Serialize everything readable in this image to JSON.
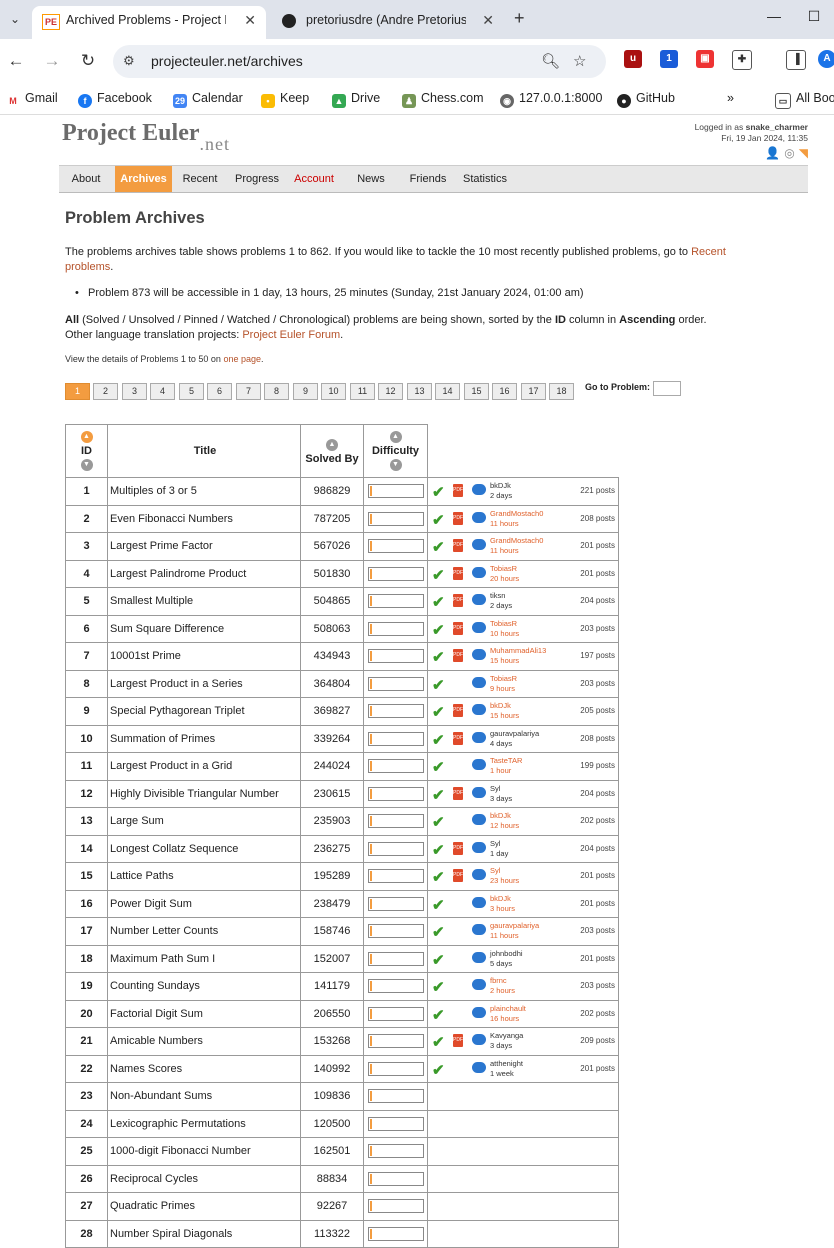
{
  "browser": {
    "tabs": [
      {
        "title": "Archived Problems - Project Eul",
        "favicon": "PE"
      },
      {
        "title": "pretoriusdre (Andre Pretorius)",
        "favicon": "github-icon"
      }
    ],
    "url": "projecteuler.net/archives",
    "bookmarks": [
      "Gmail",
      "Facebook",
      "Calendar",
      "Keep",
      "Drive",
      "Chess.com",
      "127.0.0.1:8000",
      "GitHub",
      "All Boo"
    ],
    "ext_badge": "1",
    "profile_initial": "A"
  },
  "site": {
    "logo": "Project Euler",
    "logo_suffix": ".net",
    "login_line1_prefix": "Logged in as ",
    "login_user": "snake_charmer",
    "login_line2": "Fri, 19 Jan 2024, 11:35"
  },
  "menu": [
    "About",
    "Archives",
    "Recent",
    "Progress",
    "Account",
    "News",
    "Friends",
    "Statistics"
  ],
  "page": {
    "title": "Problem Archives",
    "intro": "The problems archives table shows problems 1 to 862. If you would like to tackle the 10 most recently published problems, go to ",
    "intro_link": "Recent problems",
    "intro_end": ".",
    "bullet": "Problem 873 will be accessible in 1 day, 13 hours, 25 minutes (Sunday, 21st January 2024, 01:00 am)",
    "filter_all": "All",
    "filter_rest": " (Solved / Unsolved / Pinned / Watched / Chronological) problems are being shown, sorted by the ",
    "filter_col": "ID",
    "filter_mid": " column in ",
    "filter_order": "Ascending",
    "filter_end": " order.",
    "translation": "Other language translation projects: ",
    "translation_link": "Project Euler Forum",
    "translation_end": ".",
    "details_prefix": "View the details of Problems 1 to 50 on ",
    "details_link": "one page",
    "details_end": ".",
    "pages": [
      "1",
      "2",
      "3",
      "4",
      "5",
      "6",
      "7",
      "8",
      "9",
      "10",
      "11",
      "12",
      "13",
      "14",
      "15",
      "16",
      "17",
      "18"
    ],
    "goto_label": "Go to Problem:"
  },
  "table": {
    "headers": {
      "id": "ID",
      "title": "Title",
      "solved": "Solved By",
      "difficulty": "Difficulty"
    },
    "rows": [
      {
        "id": "1",
        "title": "Multiples of 3 or 5",
        "solved": "986829",
        "solved_me": true,
        "pdf": true,
        "forum": true,
        "user": "bkDJk",
        "ago": "2 days",
        "user_orange": false,
        "posts": "221 posts"
      },
      {
        "id": "2",
        "title": "Even Fibonacci Numbers",
        "solved": "787205",
        "solved_me": true,
        "pdf": true,
        "forum": true,
        "user": "GrandMostach0",
        "ago": "11 hours",
        "user_orange": true,
        "posts": "208 posts"
      },
      {
        "id": "3",
        "title": "Largest Prime Factor",
        "solved": "567026",
        "solved_me": true,
        "pdf": true,
        "forum": true,
        "user": "GrandMostach0",
        "ago": "11 hours",
        "user_orange": true,
        "posts": "201 posts"
      },
      {
        "id": "4",
        "title": "Largest Palindrome Product",
        "solved": "501830",
        "solved_me": true,
        "pdf": true,
        "forum": true,
        "user": "TobiasR",
        "ago": "20 hours",
        "user_orange": true,
        "posts": "201 posts"
      },
      {
        "id": "5",
        "title": "Smallest Multiple",
        "solved": "504865",
        "solved_me": true,
        "pdf": true,
        "forum": true,
        "user": "tiksn",
        "ago": "2 days",
        "user_orange": false,
        "posts": "204 posts"
      },
      {
        "id": "6",
        "title": "Sum Square Difference",
        "solved": "508063",
        "solved_me": true,
        "pdf": true,
        "forum": true,
        "user": "TobiasR",
        "ago": "10 hours",
        "user_orange": true,
        "posts": "203 posts"
      },
      {
        "id": "7",
        "title": "10001st Prime",
        "solved": "434943",
        "solved_me": true,
        "pdf": true,
        "forum": true,
        "user": "MuhammadAli13",
        "ago": "15 hours",
        "user_orange": true,
        "posts": "197 posts"
      },
      {
        "id": "8",
        "title": "Largest Product in a Series",
        "solved": "364804",
        "solved_me": true,
        "pdf": false,
        "forum": true,
        "user": "TobiasR",
        "ago": "9 hours",
        "user_orange": true,
        "posts": "203 posts"
      },
      {
        "id": "9",
        "title": "Special Pythagorean Triplet",
        "solved": "369827",
        "solved_me": true,
        "pdf": true,
        "forum": true,
        "user": "bkDJk",
        "ago": "15 hours",
        "user_orange": true,
        "posts": "205 posts"
      },
      {
        "id": "10",
        "title": "Summation of Primes",
        "solved": "339264",
        "solved_me": true,
        "pdf": true,
        "forum": true,
        "user": "gauravpalariya",
        "ago": "4 days",
        "user_orange": false,
        "posts": "208 posts"
      },
      {
        "id": "11",
        "title": "Largest Product in a Grid",
        "solved": "244024",
        "solved_me": true,
        "pdf": false,
        "forum": true,
        "user": "TasteTAR",
        "ago": "1 hour",
        "user_orange": true,
        "posts": "199 posts"
      },
      {
        "id": "12",
        "title": "Highly Divisible Triangular Number",
        "solved": "230615",
        "solved_me": true,
        "pdf": true,
        "forum": true,
        "user": "Syl",
        "ago": "3 days",
        "user_orange": false,
        "posts": "204 posts"
      },
      {
        "id": "13",
        "title": "Large Sum",
        "solved": "235903",
        "solved_me": true,
        "pdf": false,
        "forum": true,
        "user": "bkDJk",
        "ago": "12 hours",
        "user_orange": true,
        "posts": "202 posts"
      },
      {
        "id": "14",
        "title": "Longest Collatz Sequence",
        "solved": "236275",
        "solved_me": true,
        "pdf": true,
        "forum": true,
        "user": "Syl",
        "ago": "1 day",
        "user_orange": false,
        "posts": "204 posts"
      },
      {
        "id": "15",
        "title": "Lattice Paths",
        "solved": "195289",
        "solved_me": true,
        "pdf": true,
        "forum": true,
        "user": "Syl",
        "ago": "23 hours",
        "user_orange": true,
        "posts": "201 posts"
      },
      {
        "id": "16",
        "title": "Power Digit Sum",
        "solved": "238479",
        "solved_me": true,
        "pdf": false,
        "forum": true,
        "user": "bkDJk",
        "ago": "3 hours",
        "user_orange": true,
        "posts": "201 posts"
      },
      {
        "id": "17",
        "title": "Number Letter Counts",
        "solved": "158746",
        "solved_me": true,
        "pdf": false,
        "forum": true,
        "user": "gauravpalariya",
        "ago": "11 hours",
        "user_orange": true,
        "posts": "203 posts"
      },
      {
        "id": "18",
        "title": "Maximum Path Sum I",
        "solved": "152007",
        "solved_me": true,
        "pdf": false,
        "forum": true,
        "user": "johnbodhi",
        "ago": "5 days",
        "user_orange": false,
        "posts": "201 posts"
      },
      {
        "id": "19",
        "title": "Counting Sundays",
        "solved": "141179",
        "solved_me": true,
        "pdf": false,
        "forum": true,
        "user": "fbrnc",
        "ago": "2 hours",
        "user_orange": true,
        "posts": "203 posts"
      },
      {
        "id": "20",
        "title": "Factorial Digit Sum",
        "solved": "206550",
        "solved_me": true,
        "pdf": false,
        "forum": true,
        "user": "plainchault",
        "ago": "16 hours",
        "user_orange": true,
        "posts": "202 posts"
      },
      {
        "id": "21",
        "title": "Amicable Numbers",
        "solved": "153268",
        "solved_me": true,
        "pdf": true,
        "forum": true,
        "user": "Kavyanga",
        "ago": "3 days",
        "user_orange": false,
        "posts": "209 posts"
      },
      {
        "id": "22",
        "title": "Names Scores",
        "solved": "140992",
        "solved_me": true,
        "pdf": false,
        "forum": true,
        "user": "atthenight",
        "ago": "1 week",
        "user_orange": false,
        "posts": "201 posts"
      },
      {
        "id": "23",
        "title": "Non-Abundant Sums",
        "solved": "109836",
        "solved_me": false,
        "pdf": false,
        "forum": false,
        "user": "",
        "ago": "",
        "user_orange": false,
        "posts": ""
      },
      {
        "id": "24",
        "title": "Lexicographic Permutations",
        "solved": "120500",
        "solved_me": false,
        "pdf": false,
        "forum": false,
        "user": "",
        "ago": "",
        "user_orange": false,
        "posts": ""
      },
      {
        "id": "25",
        "title": "1000-digit Fibonacci Number",
        "solved": "162501",
        "solved_me": false,
        "pdf": false,
        "forum": false,
        "user": "",
        "ago": "",
        "user_orange": false,
        "posts": ""
      },
      {
        "id": "26",
        "title": "Reciprocal Cycles",
        "solved": "88834",
        "solved_me": false,
        "pdf": false,
        "forum": false,
        "user": "",
        "ago": "",
        "user_orange": false,
        "posts": ""
      },
      {
        "id": "27",
        "title": "Quadratic Primes",
        "solved": "92267",
        "solved_me": false,
        "pdf": false,
        "forum": false,
        "user": "",
        "ago": "",
        "user_orange": false,
        "posts": ""
      },
      {
        "id": "28",
        "title": "Number Spiral Diagonals",
        "solved": "113322",
        "solved_me": false,
        "pdf": false,
        "forum": false,
        "user": "",
        "ago": "",
        "user_orange": false,
        "posts": ""
      }
    ]
  },
  "colors": {
    "accent": "#f39c40",
    "link": "#b5522a",
    "check": "#3a9a2a",
    "forum": "#2a76cf"
  }
}
